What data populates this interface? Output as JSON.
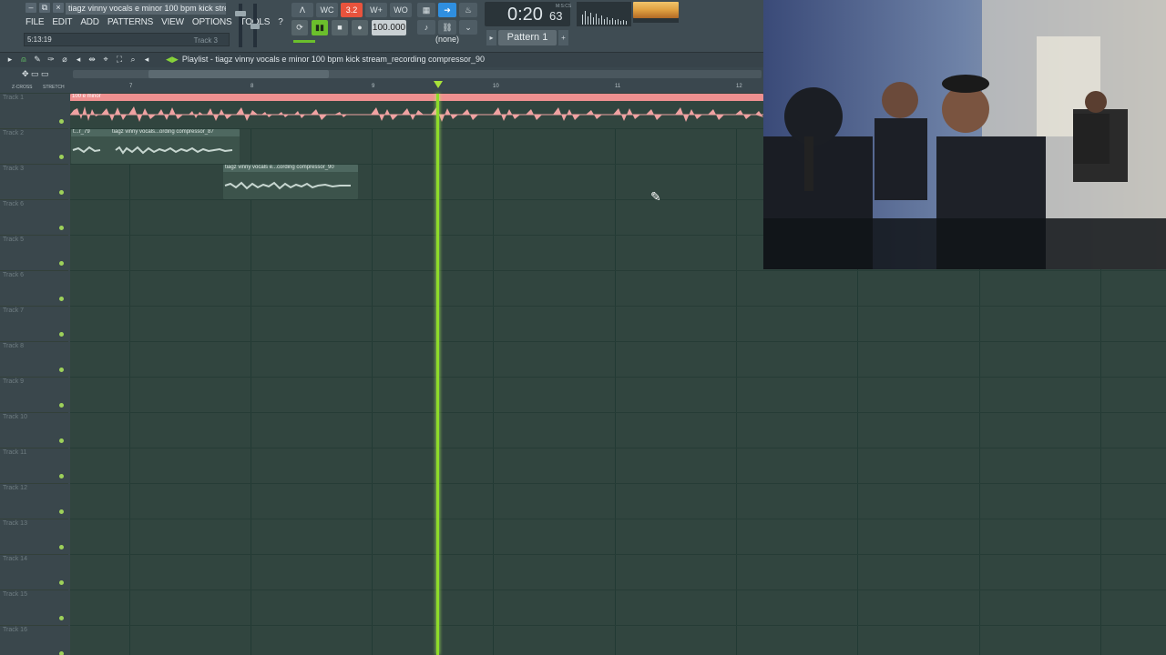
{
  "window": {
    "title": "tiagz vinny vocals e minor 100 bpm kick stream...",
    "controls": [
      "–",
      "⧉",
      "×"
    ]
  },
  "menu": [
    "FILE",
    "EDIT",
    "ADD",
    "PATTERNS",
    "VIEW",
    "OPTIONS",
    "TOOLS",
    "?"
  ],
  "hint": {
    "time": "5:13:19",
    "track": "Track 3"
  },
  "transport": {
    "tempo": "100.000",
    "song_time_main": "0:20",
    "song_time_frac": "63",
    "song_time_unit": "M:S:CS",
    "pattern": "Pattern 1",
    "pattern_filter": "(none)",
    "top_icons": [
      "ᐱ",
      "WC",
      "3.2",
      "W+",
      "WO"
    ],
    "buttons": [
      "⟳",
      "▮▮",
      "■",
      "●"
    ]
  },
  "tools2": [
    "▦",
    "➜",
    "♨",
    "♪",
    "⛓",
    "⌄"
  ],
  "playlist": {
    "title": "Playlist - tiagz vinny vocals e minor 100 bpm kick stream_recording compressor_90",
    "toolbar_icons": [
      "▸",
      "⍝",
      "✎",
      "✑",
      "⌀",
      "◂",
      "⇹",
      "⌖",
      "⛶",
      "⌕",
      "◂"
    ],
    "nav_arrows": "✥ ▭ ▭",
    "zcross": "Z-CROSS",
    "stretch": "STRETCH",
    "ruler": [
      "7",
      "8",
      "9",
      "10",
      "11",
      "12"
    ]
  },
  "tracks": [
    "Track 1",
    "Track 2",
    "Track 3",
    "Track 6",
    "Track 5",
    "Track 6",
    "Track 7",
    "Track 8",
    "Track 9",
    "Track 10",
    "Track 11",
    "Track 12",
    "Track 13",
    "Track 14",
    "Track 15",
    "Track 16"
  ],
  "clips": {
    "c1": "100 e minor",
    "c2": "t...r_79",
    "c3": "tiagz vinny vocals...ording compressor_87",
    "c4": "tiagz vinny vocals e...cording compressor_90"
  },
  "colors": {
    "accent": "#8fdc2a",
    "clip_audio": "#ee9090",
    "grid": "#31453f"
  }
}
